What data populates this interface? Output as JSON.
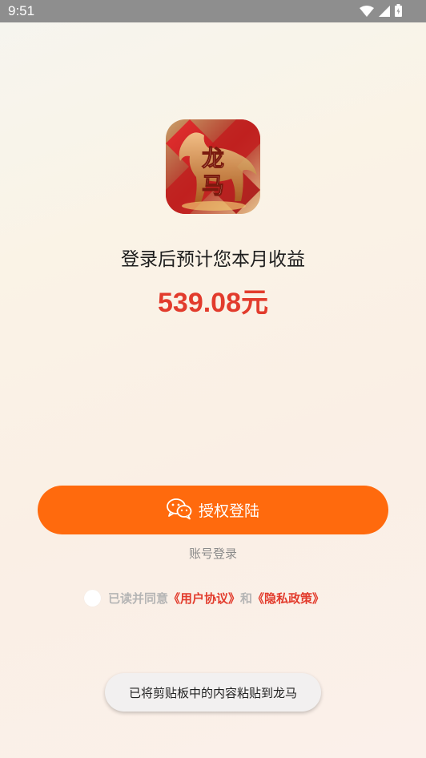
{
  "status_bar": {
    "time": "9:51"
  },
  "app": {
    "logo_text": "龙马"
  },
  "main": {
    "subtitle": "登录后预计您本月收益",
    "earnings": "539.08元"
  },
  "actions": {
    "login_label": "授权登陆",
    "account_login_label": "账号登录"
  },
  "agreement": {
    "prefix": "已读并同意",
    "user_agreement": "《用户协议》",
    "conjunction": "和",
    "privacy_policy": "《隐私政策》"
  },
  "toast": {
    "message": "已将剪贴板中的内容粘贴到龙马"
  },
  "colors": {
    "accent": "#ff6a0d",
    "earnings": "#e23b2c",
    "link": "#e23b2c"
  },
  "icons": {
    "wifi": "wifi-icon",
    "signal": "signal-icon",
    "battery": "battery-icon",
    "wechat": "wechat-icon"
  }
}
